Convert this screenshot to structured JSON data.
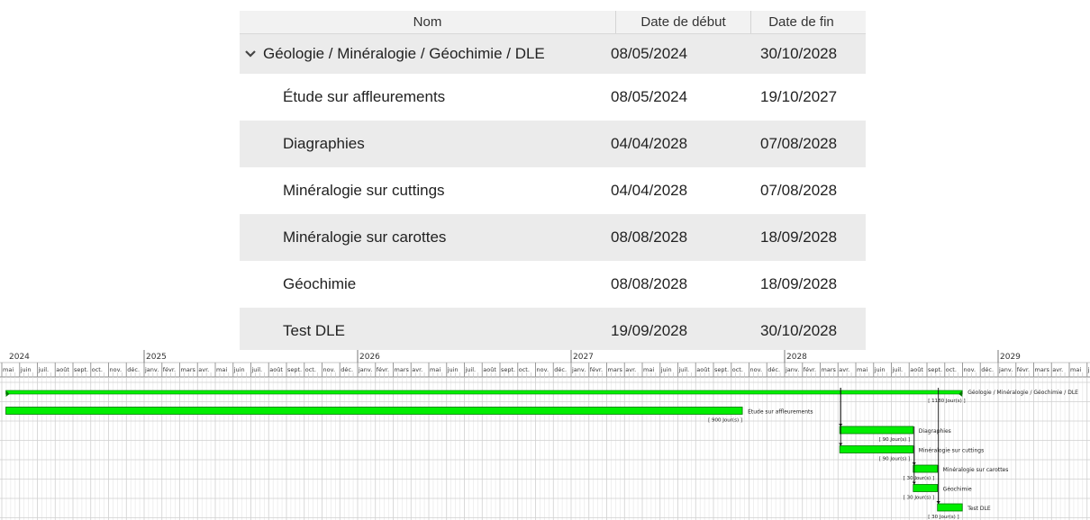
{
  "table": {
    "headers": {
      "name": "Nom",
      "start": "Date de début",
      "end": "Date de fin"
    },
    "rows": [
      {
        "name": "Géologie / Minéralogie / Géochimie / DLE",
        "start": "08/05/2024",
        "end": "30/10/2028",
        "group": true
      },
      {
        "name": "Étude sur affleurements",
        "start": "08/05/2024",
        "end": "19/10/2027"
      },
      {
        "name": "Diagraphies",
        "start": "04/04/2028",
        "end": "07/08/2028"
      },
      {
        "name": "Minéralogie sur cuttings",
        "start": "04/04/2028",
        "end": "07/08/2028"
      },
      {
        "name": "Minéralogie sur carottes",
        "start": "08/08/2028",
        "end": "18/09/2028"
      },
      {
        "name": "Géochimie",
        "start": "08/08/2028",
        "end": "18/09/2028"
      },
      {
        "name": "Test DLE",
        "start": "19/09/2028",
        "end": "30/10/2028"
      }
    ]
  },
  "gantt": {
    "years": [
      "2024",
      "2025",
      "2026",
      "2027",
      "2028",
      "2029"
    ],
    "months": [
      "mai",
      "juin",
      "juil.",
      "août",
      "sept.",
      "oct.",
      "nov.",
      "déc.",
      "janv.",
      "févr.",
      "mars",
      "avr."
    ],
    "bars": [
      {
        "label": "Géologie / Minéralogie / Géochimie / DLE",
        "duration": "[ 1180 Jour(s) ]",
        "summary": true
      },
      {
        "label": "Étude sur affleurements",
        "duration": "[ 900 Jour(s) ]"
      },
      {
        "label": "Diagraphies",
        "duration": "[ 90 Jour(s) ]"
      },
      {
        "label": "Minéralogie sur cuttings",
        "duration": "[ 90 Jour(s) ]"
      },
      {
        "label": "Minéralogie sur carottes",
        "duration": "[ 30 Jour(s) ]"
      },
      {
        "label": "Géochimie",
        "duration": "[ 30 Jour(s) ]"
      },
      {
        "label": "Test DLE",
        "duration": "[ 30 Jour(s) ]"
      }
    ],
    "colors": {
      "bar": "#00ee00",
      "bar_border": "#007700",
      "grid": "#d0d0d0"
    }
  }
}
